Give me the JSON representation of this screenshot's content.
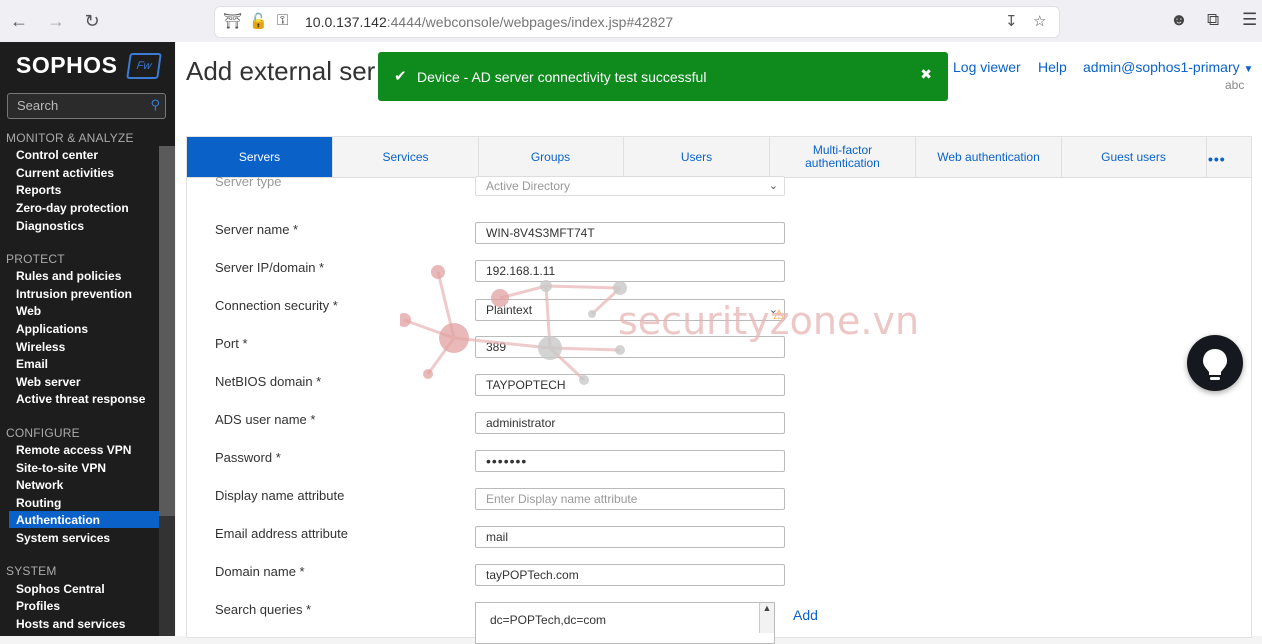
{
  "browser": {
    "url_host": "10.0.137.142",
    "url_path": ":4444/webconsole/webpages/index.jsp#42827"
  },
  "sidebar": {
    "logo": "SOPHOS",
    "badge": "Fw",
    "search_placeholder": "Search",
    "sections": [
      {
        "title": "MONITOR & ANALYZE",
        "items": [
          "Control center",
          "Current activities",
          "Reports",
          "Zero-day protection",
          "Diagnostics"
        ]
      },
      {
        "title": "PROTECT",
        "items": [
          "Rules and policies",
          "Intrusion prevention",
          "Web",
          "Applications",
          "Wireless",
          "Email",
          "Web server",
          "Active threat response"
        ]
      },
      {
        "title": "CONFIGURE",
        "items": [
          "Remote access VPN",
          "Site-to-site VPN",
          "Network",
          "Routing",
          "Authentication",
          "System services"
        ]
      },
      {
        "title": "SYSTEM",
        "items": [
          "Sophos Central",
          "Profiles",
          "Hosts and services"
        ]
      }
    ],
    "active_item": "Authentication"
  },
  "header": {
    "title": "Add external ser",
    "log_viewer": "Log viewer",
    "help": "Help",
    "user": "admin@sophos1-primary",
    "user_sub": "abc"
  },
  "toast": {
    "message": "Device - AD server connectivity test successful"
  },
  "tabs": [
    "Servers",
    "Services",
    "Groups",
    "Users",
    "Multi-factor authentication",
    "Web authentication",
    "Guest users"
  ],
  "active_tab": "Servers",
  "form": {
    "server_type_label": "Server type",
    "server_type_value": "Active Directory",
    "server_name_label": "Server name *",
    "server_name_value": "WIN-8V4S3MFT74T",
    "server_ip_label": "Server IP/domain *",
    "server_ip_value": "192.168.1.11",
    "conn_security_label": "Connection security *",
    "conn_security_value": "Plaintext",
    "port_label": "Port *",
    "port_value": "389",
    "netbios_label": "NetBIOS domain *",
    "netbios_value": "TAYPOPTECH",
    "ads_user_label": "ADS user name *",
    "ads_user_value": "administrator",
    "password_label": "Password *",
    "password_value": "•••••••",
    "display_name_label": "Display name attribute",
    "display_name_placeholder": "Enter Display name attribute",
    "email_attr_label": "Email address attribute",
    "email_attr_value": "mail",
    "domain_name_label": "Domain name *",
    "domain_name_value": "tayPOPTech.com",
    "search_queries_label": "Search queries *",
    "search_queries_value": "dc=POPTech,dc=com",
    "add_label": "Add"
  },
  "watermark": "securityzone.vn"
}
